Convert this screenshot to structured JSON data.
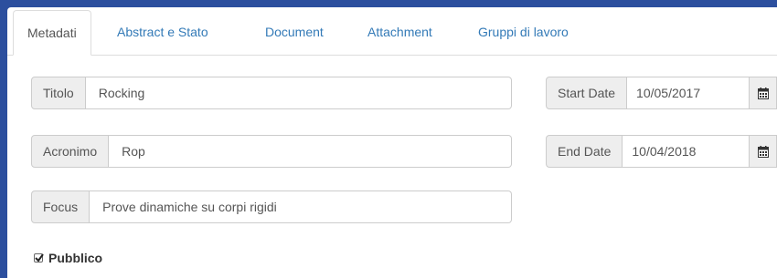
{
  "tabs": [
    {
      "label": "Metadati",
      "active": true
    },
    {
      "label": "Abstract e Stato",
      "active": false
    },
    {
      "label": "Document",
      "active": false
    },
    {
      "label": "Attachment",
      "active": false
    },
    {
      "label": "Gruppi di lavoro",
      "active": false
    }
  ],
  "form": {
    "titolo": {
      "label": "Titolo",
      "value": "Rocking"
    },
    "acronimo": {
      "label": "Acronimo",
      "value": "Rop"
    },
    "focus": {
      "label": "Focus",
      "value": "Prove dinamiche su corpi rigidi"
    },
    "start_date": {
      "label": "Start Date",
      "value": "10/05/2017"
    },
    "end_date": {
      "label": "End Date",
      "value": "10/04/2018"
    },
    "pubblico": {
      "label": "Pubblico",
      "checked": true
    }
  },
  "icons": {
    "calendar": "calendar-icon",
    "check": "checkmark-icon"
  },
  "colors": {
    "background": "#2c4f9e",
    "link": "#337ab7",
    "addon": "#eeeeee",
    "border": "#cccccc"
  }
}
